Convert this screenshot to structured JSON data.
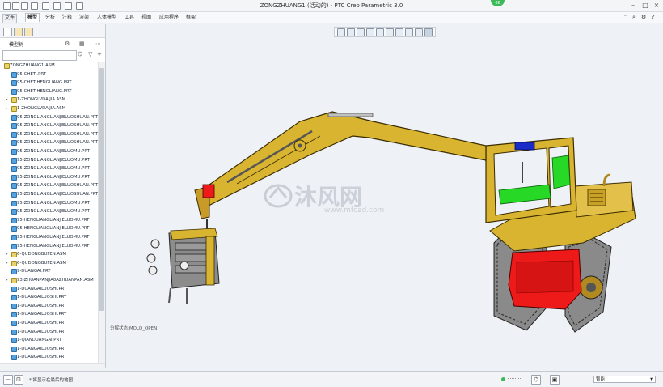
{
  "window": {
    "title": "ZONGZHUANG1 (活动的) - PTC Creo Parametric 3.0",
    "badge": "66"
  },
  "ribbon": {
    "tabs": [
      "文件",
      "模型",
      "分析",
      "注释",
      "渲染",
      "人体模型",
      "工具",
      "视图",
      "应用程序",
      "框架"
    ],
    "active_tab": "模型"
  },
  "model_tree": {
    "title": "模型树",
    "search_placeholder": "",
    "items": [
      {
        "label": "ZONGZHUANG1.ASM",
        "type": "asm",
        "level": 0,
        "expandable": false
      },
      {
        "label": "95-CHETI.PRT",
        "type": "prt",
        "level": 1,
        "expandable": false
      },
      {
        "label": "95-CHETIHENGLIANG.PRT",
        "type": "prt",
        "level": 1,
        "expandable": false
      },
      {
        "label": "95-CHETIHENGLIANG.PRT",
        "type": "prt",
        "level": 1,
        "expandable": false
      },
      {
        "label": "1-ZHONGLVDAIJIA.ASM",
        "type": "asm",
        "level": 1,
        "expandable": true
      },
      {
        "label": "1-ZHONGLVDAIJIA.ASM",
        "type": "asm",
        "level": 1,
        "expandable": true
      },
      {
        "label": "95-ZONGLIANGLIANJIELUOSHUAN.PRT",
        "type": "prt",
        "level": 1,
        "expandable": false
      },
      {
        "label": "95-ZONGLIANGLIANJIELUOSHUAN.PRT",
        "type": "prt",
        "level": 1,
        "expandable": false
      },
      {
        "label": "95-ZONGLIANGLIANJIELUOSHUAN.PRT",
        "type": "prt",
        "level": 1,
        "expandable": false
      },
      {
        "label": "95-ZONGLIANGLIANJIELUOSHUAN.PRT",
        "type": "prt",
        "level": 1,
        "expandable": false
      },
      {
        "label": "95-ZONGLIANGLIANJIELUOMU.PRT",
        "type": "prt",
        "level": 1,
        "expandable": false
      },
      {
        "label": "95-ZONGLIANGLIANJIELUOMU.PRT",
        "type": "prt",
        "level": 1,
        "expandable": false
      },
      {
        "label": "95-ZONGLIANGLIANJIELUOMU.PRT",
        "type": "prt",
        "level": 1,
        "expandable": false
      },
      {
        "label": "95-ZONGLIANGLIANJIELUOMU.PRT",
        "type": "prt",
        "level": 1,
        "expandable": false
      },
      {
        "label": "95-ZONGLIANGLIANJIELUOSHUAN.PRT",
        "type": "prt",
        "level": 1,
        "expandable": false
      },
      {
        "label": "95-ZONGLIANGLIANJIELUOSHUAN.PRT",
        "type": "prt",
        "level": 1,
        "expandable": false
      },
      {
        "label": "95-ZONGLIANGLIANJIELUOMU.PRT",
        "type": "prt",
        "level": 1,
        "expandable": false
      },
      {
        "label": "95-ZONGLIANGLIANJIELUOMU.PRT",
        "type": "prt",
        "level": 1,
        "expandable": false
      },
      {
        "label": "95-HENGLIANGLIANJIELUOMU.PRT",
        "type": "prt",
        "level": 1,
        "expandable": false
      },
      {
        "label": "95-HENGLIANGLIANJIELUOMU.PRT",
        "type": "prt",
        "level": 1,
        "expandable": false
      },
      {
        "label": "95-HENGLIANGLIANJIELUOMU.PRT",
        "type": "prt",
        "level": 1,
        "expandable": false
      },
      {
        "label": "95-HENGLIANGLIANJIELUOMU.PRT",
        "type": "prt",
        "level": 1,
        "expandable": false
      },
      {
        "label": "6-QUDONGBUFEN.ASM",
        "type": "asm",
        "level": 1,
        "expandable": true
      },
      {
        "label": "6-QUDONGBUFEN.ASM",
        "type": "asm",
        "level": 1,
        "expandable": true
      },
      {
        "label": "9-DUANGAI.PRT",
        "type": "prt",
        "level": 1,
        "expandable": false
      },
      {
        "label": "93-ZHUANPANJIA8AZHUANPAN.ASM",
        "type": "asm",
        "level": 1,
        "expandable": true
      },
      {
        "label": "1-DUANGAILUOSHI.PRT",
        "type": "prt",
        "level": 1,
        "expandable": false
      },
      {
        "label": "1-DUANGAILUOSHI.PRT",
        "type": "prt",
        "level": 1,
        "expandable": false
      },
      {
        "label": "1-DUANGAILUOSHI.PRT",
        "type": "prt",
        "level": 1,
        "expandable": false
      },
      {
        "label": "1-DUANGAILUOSHI.PRT",
        "type": "prt",
        "level": 1,
        "expandable": false
      },
      {
        "label": "1-DUANGAILUOSHI.PRT",
        "type": "prt",
        "level": 1,
        "expandable": false
      },
      {
        "label": "1-DUANGAILUOSHI.PRT",
        "type": "prt",
        "level": 1,
        "expandable": false
      },
      {
        "label": "1-QIANDUANGAI.PRT",
        "type": "prt",
        "level": 1,
        "expandable": false
      },
      {
        "label": "1-DUANGAILUOSHI.PRT",
        "type": "prt",
        "level": 1,
        "expandable": false
      },
      {
        "label": "1-DUANGAILUOSHI.PRT",
        "type": "prt",
        "level": 1,
        "expandable": false
      }
    ]
  },
  "graphics": {
    "state_label": "分解状态:MOLD_OPEN",
    "watermark_cn": "沐风网",
    "watermark_url": "www.mfcad.com"
  },
  "statusbar": {
    "message": "* 将显示在最后的地图",
    "filter_value": "智能"
  },
  "colors": {
    "body_yellow": "#d9b430",
    "cab_green": "#27d827",
    "base_red": "#ee1a1a",
    "window_blue": "#1a2cc8",
    "track_gray": "#7a7a7a"
  }
}
